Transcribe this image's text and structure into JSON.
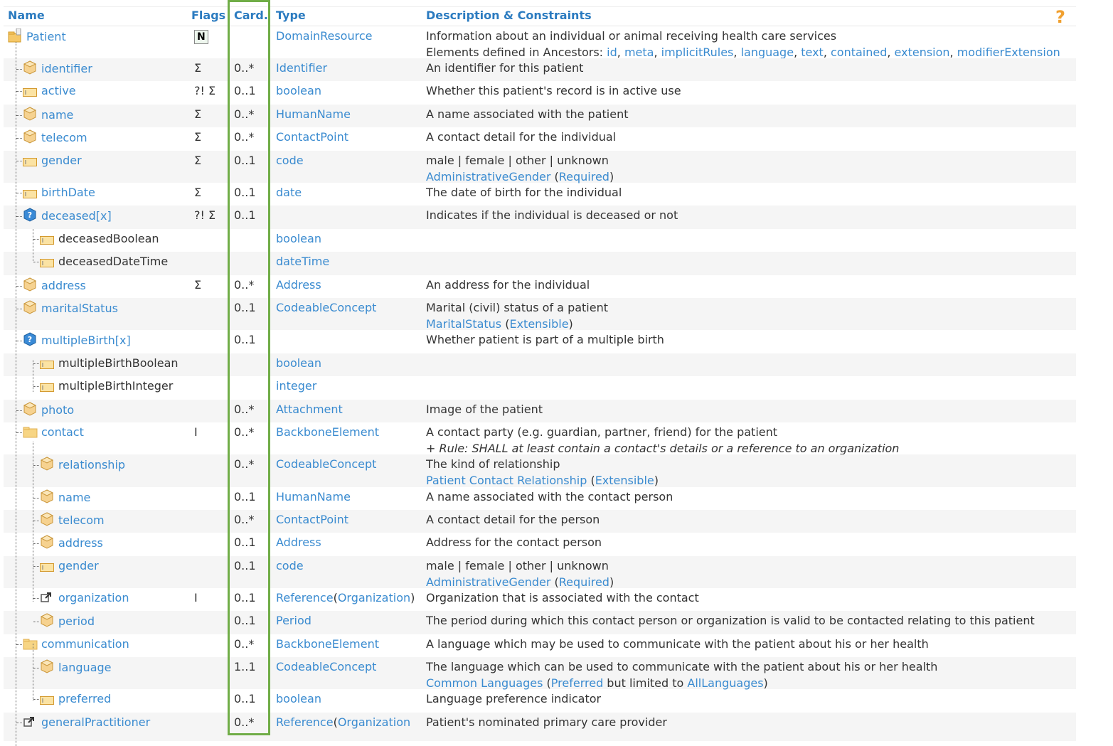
{
  "header": {
    "name": "Name",
    "flags": "Flags",
    "card": "Card.",
    "type": "Type",
    "desc": "Description & Constraints",
    "help_icon": "help-icon"
  },
  "rows": [
    {
      "name": "Patient",
      "depth": 0,
      "icon": "resource-icon",
      "flags": "N",
      "card": "",
      "type": [
        {
          "t": "DomainResource",
          "link": true
        }
      ],
      "desc": [
        [
          {
            "t": "Information about an individual or animal receiving health care services"
          }
        ],
        [
          {
            "t": "Elements defined in Ancestors: "
          },
          {
            "t": "id",
            "link": true
          },
          {
            "t": ", "
          },
          {
            "t": "meta",
            "link": true
          },
          {
            "t": ", "
          },
          {
            "t": "implicitRules",
            "link": true
          },
          {
            "t": ", "
          },
          {
            "t": "language",
            "link": true
          },
          {
            "t": ", "
          },
          {
            "t": "text",
            "link": true
          },
          {
            "t": ", "
          },
          {
            "t": "contained",
            "link": true
          },
          {
            "t": ", "
          },
          {
            "t": "extension",
            "link": true
          },
          {
            "t": ", "
          },
          {
            "t": "modifierExtension",
            "link": true
          }
        ]
      ],
      "gray": false,
      "h": 45
    },
    {
      "name": "identifier",
      "depth": 1,
      "icon": "datatype-icon",
      "flags": "Σ",
      "card": "0..*",
      "type": [
        {
          "t": "Identifier",
          "link": true
        }
      ],
      "desc": [
        [
          {
            "t": "An identifier for this patient"
          }
        ]
      ],
      "gray": true,
      "h": 32
    },
    {
      "name": "active",
      "depth": 1,
      "icon": "primitive-icon",
      "flags": "?! Σ",
      "card": "0..1",
      "type": [
        {
          "t": "boolean",
          "link": true
        }
      ],
      "desc": [
        [
          {
            "t": "Whether this patient's record is in active use"
          }
        ]
      ],
      "gray": false,
      "h": 33
    },
    {
      "name": "name",
      "depth": 1,
      "icon": "datatype-icon",
      "flags": "Σ",
      "card": "0..*",
      "type": [
        {
          "t": "HumanName",
          "link": true
        }
      ],
      "desc": [
        [
          {
            "t": "A name associated with the patient"
          }
        ]
      ],
      "gray": true,
      "h": 32
    },
    {
      "name": "telecom",
      "depth": 1,
      "icon": "datatype-icon",
      "flags": "Σ",
      "card": "0..*",
      "type": [
        {
          "t": "ContactPoint",
          "link": true
        }
      ],
      "desc": [
        [
          {
            "t": "A contact detail for the individual"
          }
        ]
      ],
      "gray": false,
      "h": 33
    },
    {
      "name": "gender",
      "depth": 1,
      "icon": "primitive-icon",
      "flags": "Σ",
      "card": "0..1",
      "type": [
        {
          "t": "code",
          "link": true
        }
      ],
      "desc": [
        [
          {
            "t": "male | female | other | unknown"
          }
        ],
        [
          {
            "t": "AdministrativeGender",
            "link": true
          },
          {
            "t": " ("
          },
          {
            "t": "Required",
            "link": true
          },
          {
            "t": ")"
          }
        ]
      ],
      "gray": true,
      "h": 45
    },
    {
      "name": "birthDate",
      "depth": 1,
      "icon": "primitive-icon",
      "flags": "Σ",
      "card": "0..1",
      "type": [
        {
          "t": "date",
          "link": true
        }
      ],
      "desc": [
        [
          {
            "t": "The date of birth for the individual"
          }
        ]
      ],
      "gray": false,
      "h": 32
    },
    {
      "name": "deceased[x]",
      "depth": 1,
      "icon": "choice-icon",
      "flags": "?! Σ",
      "card": "0..1",
      "type": [],
      "desc": [
        [
          {
            "t": "Indicates if the individual is deceased or not"
          }
        ]
      ],
      "gray": true,
      "h": 33
    },
    {
      "name": "deceasedBoolean",
      "depth": 2,
      "icon": "primitive-icon",
      "plain": true,
      "flags": "",
      "card": "",
      "type": [
        {
          "t": "boolean",
          "link": true
        }
      ],
      "desc": [],
      "gray": false,
      "h": 32
    },
    {
      "name": "deceasedDateTime",
      "depth": 2,
      "icon": "primitive-icon",
      "plain": true,
      "flags": "",
      "card": "",
      "type": [
        {
          "t": "dateTime",
          "link": true
        }
      ],
      "desc": [],
      "gray": true,
      "h": 33
    },
    {
      "name": "address",
      "depth": 1,
      "icon": "datatype-icon",
      "flags": "Σ",
      "card": "0..*",
      "type": [
        {
          "t": "Address",
          "link": true
        }
      ],
      "desc": [
        [
          {
            "t": "An address for the individual"
          }
        ]
      ],
      "gray": false,
      "h": 32
    },
    {
      "name": "maritalStatus",
      "depth": 1,
      "icon": "datatype-icon",
      "flags": "",
      "card": "0..1",
      "type": [
        {
          "t": "CodeableConcept",
          "link": true
        }
      ],
      "desc": [
        [
          {
            "t": "Marital (civil) status of a patient"
          }
        ],
        [
          {
            "t": "MaritalStatus",
            "link": true
          },
          {
            "t": " ("
          },
          {
            "t": "Extensible",
            "link": true
          },
          {
            "t": ")"
          }
        ]
      ],
      "gray": true,
      "h": 45
    },
    {
      "name": "multipleBirth[x]",
      "depth": 1,
      "icon": "choice-icon",
      "flags": "",
      "card": "0..1",
      "type": [],
      "desc": [
        [
          {
            "t": "Whether patient is part of a multiple birth"
          }
        ]
      ],
      "gray": false,
      "h": 33
    },
    {
      "name": "multipleBirthBoolean",
      "depth": 2,
      "icon": "primitive-icon",
      "plain": true,
      "flags": "",
      "card": "",
      "type": [
        {
          "t": "boolean",
          "link": true
        }
      ],
      "desc": [],
      "gray": true,
      "h": 32
    },
    {
      "name": "multipleBirthInteger",
      "depth": 2,
      "icon": "primitive-icon",
      "plain": true,
      "flags": "",
      "card": "",
      "type": [
        {
          "t": "integer",
          "link": true
        }
      ],
      "desc": [],
      "gray": false,
      "h": 33
    },
    {
      "name": "photo",
      "depth": 1,
      "icon": "datatype-icon",
      "flags": "",
      "card": "0..*",
      "type": [
        {
          "t": "Attachment",
          "link": true
        }
      ],
      "desc": [
        [
          {
            "t": "Image of the patient"
          }
        ]
      ],
      "gray": true,
      "h": 32
    },
    {
      "name": "contact",
      "depth": 1,
      "icon": "element-icon",
      "flags": "I",
      "card": "0..*",
      "type": [
        {
          "t": "BackboneElement",
          "link": true
        }
      ],
      "desc": [
        [
          {
            "t": "A contact party (e.g. guardian, partner, friend) for the patient"
          }
        ],
        [
          {
            "t": "+ Rule: SHALL at least contain a contact's details or a reference to an organization",
            "ital": true
          }
        ]
      ],
      "gray": false,
      "h": 45
    },
    {
      "name": "relationship",
      "depth": 2,
      "icon": "datatype-icon",
      "flags": "",
      "card": "0..*",
      "type": [
        {
          "t": "CodeableConcept",
          "link": true
        }
      ],
      "desc": [
        [
          {
            "t": "The kind of relationship"
          }
        ],
        [
          {
            "t": "Patient Contact Relationship",
            "link": true
          },
          {
            "t": " ("
          },
          {
            "t": "Extensible",
            "link": true
          },
          {
            "t": ")"
          }
        ]
      ],
      "gray": true,
      "h": 46
    },
    {
      "name": "name",
      "depth": 2,
      "icon": "datatype-icon",
      "flags": "",
      "card": "0..1",
      "type": [
        {
          "t": "HumanName",
          "link": true
        }
      ],
      "desc": [
        [
          {
            "t": "A name associated with the contact person"
          }
        ]
      ],
      "gray": false,
      "h": 32
    },
    {
      "name": "telecom",
      "depth": 2,
      "icon": "datatype-icon",
      "flags": "",
      "card": "0..*",
      "type": [
        {
          "t": "ContactPoint",
          "link": true
        }
      ],
      "desc": [
        [
          {
            "t": "A contact detail for the person"
          }
        ]
      ],
      "gray": true,
      "h": 32
    },
    {
      "name": "address",
      "depth": 2,
      "icon": "datatype-icon",
      "flags": "",
      "card": "0..1",
      "type": [
        {
          "t": "Address",
          "link": true
        }
      ],
      "desc": [
        [
          {
            "t": "Address for the contact person"
          }
        ]
      ],
      "gray": false,
      "h": 33
    },
    {
      "name": "gender",
      "depth": 2,
      "icon": "primitive-icon",
      "flags": "",
      "card": "0..1",
      "type": [
        {
          "t": "code",
          "link": true
        }
      ],
      "desc": [
        [
          {
            "t": "male | female | other | unknown"
          }
        ],
        [
          {
            "t": "AdministrativeGender",
            "link": true
          },
          {
            "t": " ("
          },
          {
            "t": "Required",
            "link": true
          },
          {
            "t": ")"
          }
        ]
      ],
      "gray": true,
      "h": 45
    },
    {
      "name": "organization",
      "depth": 2,
      "icon": "reference-icon",
      "flags": "I",
      "card": "0..1",
      "type": [
        {
          "t": "Reference",
          "link": true
        },
        {
          "t": "("
        },
        {
          "t": "Organization",
          "link": true
        },
        {
          "t": ")"
        }
      ],
      "desc": [
        [
          {
            "t": "Organization that is associated with the contact"
          }
        ]
      ],
      "gray": false,
      "h": 32
    },
    {
      "name": "period",
      "depth": 2,
      "icon": "datatype-icon",
      "flags": "",
      "card": "0..1",
      "type": [
        {
          "t": "Period",
          "link": true
        }
      ],
      "desc": [
        [
          {
            "t": "The period during which this contact person or organization is valid to be contacted relating to this patient"
          }
        ]
      ],
      "gray": true,
      "h": 33
    },
    {
      "name": "communication",
      "depth": 1,
      "icon": "element-icon",
      "flags": "",
      "card": "0..*",
      "type": [
        {
          "t": "BackboneElement",
          "link": true
        }
      ],
      "desc": [
        [
          {
            "t": "A language which may be used to communicate with the patient about his or her health"
          }
        ]
      ],
      "gray": false,
      "h": 32
    },
    {
      "name": "language",
      "depth": 2,
      "icon": "datatype-icon",
      "flags": "",
      "card": "1..1",
      "type": [
        {
          "t": "CodeableConcept",
          "link": true
        }
      ],
      "desc": [
        [
          {
            "t": "The language which can be used to communicate with the patient about his or her health"
          }
        ],
        [
          {
            "t": "Common Languages",
            "link": true
          },
          {
            "t": " ("
          },
          {
            "t": "Preferred",
            "link": true
          },
          {
            "t": " but limited to "
          },
          {
            "t": "AllLanguages",
            "link": true
          },
          {
            "t": ")"
          }
        ]
      ],
      "gray": true,
      "h": 45
    },
    {
      "name": "preferred",
      "depth": 2,
      "icon": "primitive-icon",
      "flags": "",
      "card": "0..1",
      "type": [
        {
          "t": "boolean",
          "link": true
        }
      ],
      "desc": [
        [
          {
            "t": "Language preference indicator"
          }
        ]
      ],
      "gray": false,
      "h": 33
    },
    {
      "name": "generalPractitioner",
      "depth": 1,
      "icon": "reference-icon",
      "flags": "",
      "card": "0..*",
      "type": [
        {
          "t": "Reference",
          "link": true
        },
        {
          "t": "("
        },
        {
          "t": "Organization",
          "link": true
        }
      ],
      "desc": [
        [
          {
            "t": "Patient's nominated primary care provider"
          }
        ]
      ],
      "gray": true,
      "h": 40
    }
  ]
}
